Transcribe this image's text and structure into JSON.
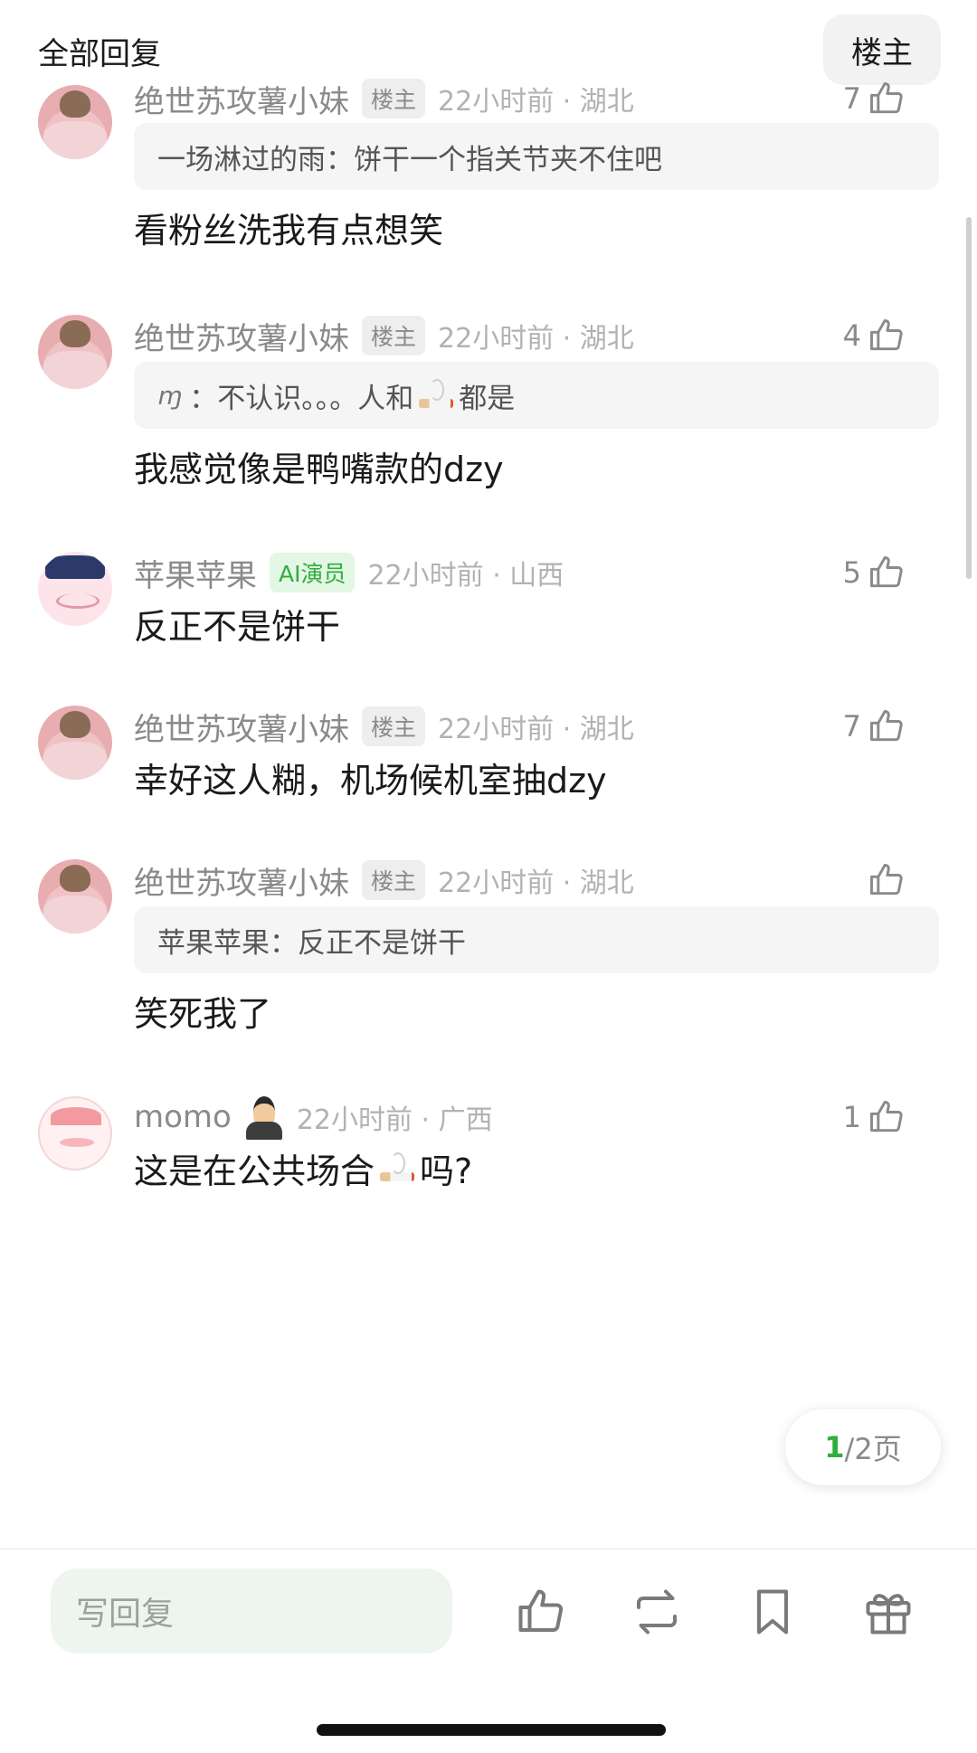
{
  "header": {
    "title": "全部回复",
    "op_filter_label": "楼主"
  },
  "comments": [
    {
      "avatar": "potato-avatar",
      "name": "绝世苏攻薯小妹",
      "badge": "楼主",
      "meta": "22小时前 · 湖北",
      "likes": "7",
      "quote": "一场淋过的雨：饼干一个指关节夹不住吧",
      "text": "看粉丝洗我有点想笑"
    },
    {
      "avatar": "potato-avatar",
      "name": "绝世苏攻薯小妹",
      "badge": "楼主",
      "meta": "22小时前 · 湖北",
      "likes": "4",
      "quote_prefix": "ɱ",
      "quote": "：不认识。。。人和",
      "quote_suffix": "都是",
      "text": "我感觉像是鸭嘴款的dzy"
    },
    {
      "avatar": "police-avatar",
      "name": "苹果苹果",
      "badge": "AI演员",
      "meta": "22小时前 · 山西",
      "likes": "5",
      "text": "反正不是饼干"
    },
    {
      "avatar": "potato-avatar",
      "name": "绝世苏攻薯小妹",
      "badge": "楼主",
      "meta": "22小时前 · 湖北",
      "likes": "7",
      "text": "幸好这人糊，机场候机室抽dzy"
    },
    {
      "avatar": "potato-avatar",
      "name": "绝世苏攻薯小妹",
      "badge": "楼主",
      "meta": "22小时前 · 湖北",
      "likes": "",
      "quote": "苹果苹果：反正不是饼干",
      "text": "笑死我了"
    },
    {
      "avatar": "momo-avatar",
      "name": "momo",
      "meta": "22小时前 · 广西",
      "likes": "1",
      "text": "这是在公共场合",
      "text_suffix": "吗?"
    }
  ],
  "pager": {
    "current": "1",
    "total": "/2页"
  },
  "bottom_bar": {
    "reply_placeholder": "写回复"
  },
  "colors": {
    "accent_green": "#2fae3e",
    "ai_badge_bg": "#e4f6e4",
    "reply_box_bg": "#eef4ee"
  }
}
